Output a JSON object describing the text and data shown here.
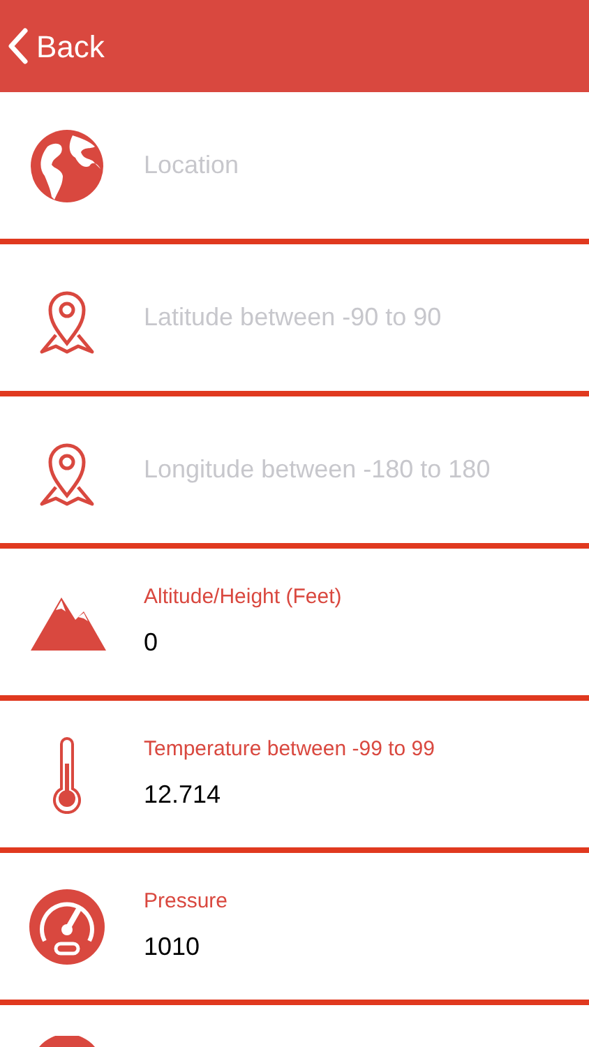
{
  "nav_bar": {
    "back_label": "Back"
  },
  "fields": [
    {
      "kind": "placeholder",
      "placeholder": "Location"
    },
    {
      "kind": "placeholder",
      "placeholder": "Latitude between -90 to 90"
    },
    {
      "kind": "placeholder",
      "placeholder": "Longitude between -180 to 180"
    },
    {
      "kind": "labeled",
      "label": "Altitude/Height (Feet)",
      "value": "0"
    },
    {
      "kind": "labeled",
      "label": "Temperature between -99 to 99",
      "value": "12.714"
    },
    {
      "kind": "labeled",
      "label": "Pressure",
      "value": "1010"
    },
    {
      "kind": "partial"
    }
  ]
}
